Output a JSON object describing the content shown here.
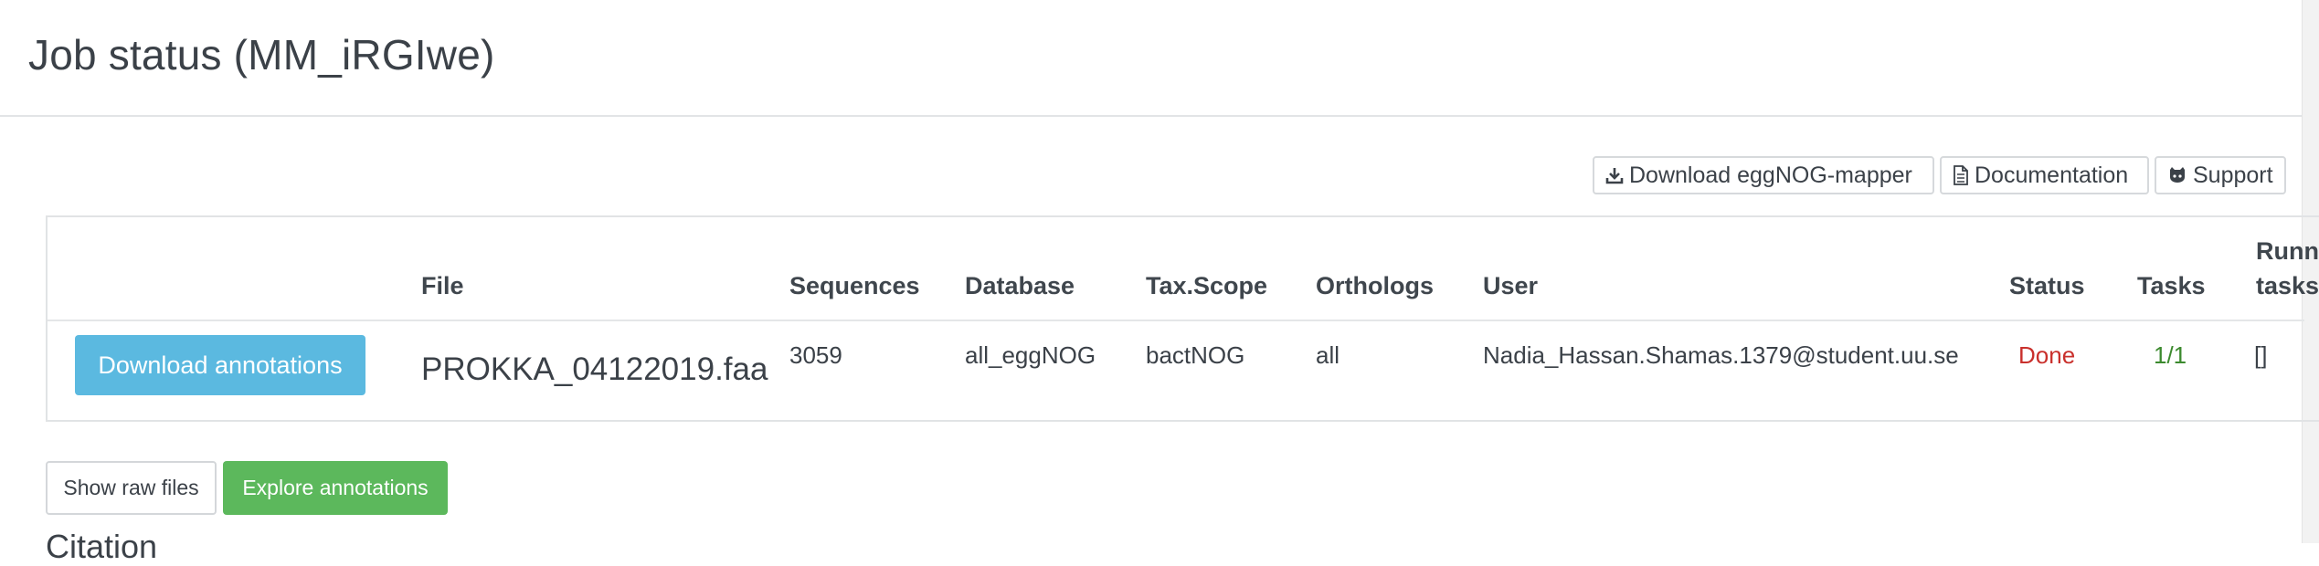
{
  "header": {
    "title": "Job status (MM_iRGIwe)"
  },
  "toolbar": {
    "download_mapper_label": "Download eggNOG-mapper",
    "documentation_label": "Documentation",
    "support_label": "Support"
  },
  "table": {
    "columns": {
      "file": "File",
      "sequences": "Sequences",
      "database": "Database",
      "tax_scope": "Tax.Scope",
      "orthologs": "Orthologs",
      "user": "User",
      "status": "Status",
      "tasks": "Tasks",
      "running_tasks_line1": "Running",
      "running_tasks_line2": "tasks"
    },
    "row": {
      "download_annotations_label": "Download annotations",
      "file": "PROKKA_04122019.faa",
      "sequences": "3059",
      "database": "all_eggNOG",
      "tax_scope": "bactNOG",
      "orthologs": "all",
      "user": "Nadia_Hassan.Shamas.1379@student.uu.se",
      "status": "Done",
      "tasks": "1/1",
      "running_tasks": "[]"
    }
  },
  "actions": {
    "show_raw_files_label": "Show raw files",
    "explore_annotations_label": "Explore annotations"
  },
  "citation": {
    "heading": "Citation"
  },
  "colors": {
    "info_button": "#5bb9e0",
    "success_button": "#5cb85c",
    "status_done": "#c9302c",
    "tasks_value": "#3c8a2e"
  },
  "icons": {
    "download": "download-icon",
    "documentation": "document-icon",
    "support": "github-icon"
  }
}
